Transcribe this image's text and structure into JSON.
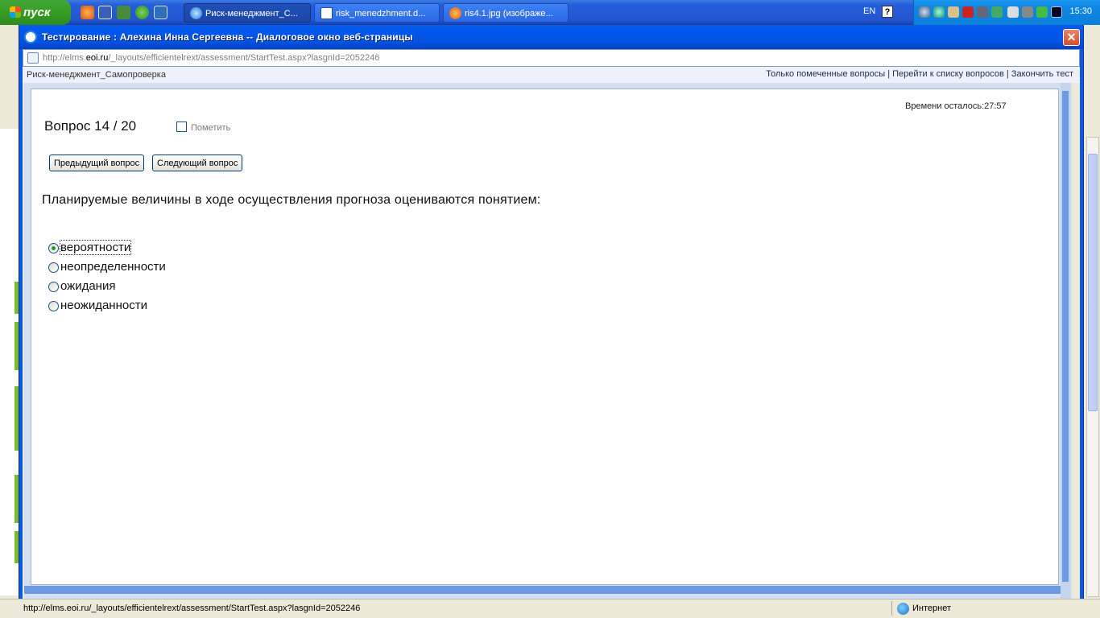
{
  "taskbar": {
    "start_label": "пуск",
    "tasks": [
      {
        "label": "Риск-менеджмент_С...",
        "icon": "ie-icon",
        "active": true
      },
      {
        "label": "risk_menedzhment.d...",
        "icon": "word-doc-icon",
        "active": false
      },
      {
        "label": "ris4.1.jpg (изображе...",
        "icon": "firefox-icon",
        "active": false
      }
    ],
    "language": "EN",
    "help": "?",
    "clock": "15:30"
  },
  "dialog": {
    "title": "Тестирование : Алехина Инна Сергеевна -- Диалоговое окно веб-страницы",
    "close_label": "✕",
    "address": {
      "prefix": "http://elms.",
      "domain": "eoi.ru",
      "path": "/_layouts/efficientelrext/assessment/StartTest.aspx?lasgnId=2052246"
    },
    "course_name": "Риск-менеджмент_Самопроверка",
    "links": {
      "marked_only": "Только помеченные вопросы",
      "sep1": "|",
      "go_to_list": "Перейти к списку вопросов",
      "sep2": "|",
      "finish": "Закончить тест"
    }
  },
  "test": {
    "time_left": "Времени осталось:27:57",
    "question_title": "Вопрос 14 / 20",
    "mark_label": "Пометить",
    "prev_button": "Предыдущий вопрос",
    "next_button": "Следующий вопрос",
    "question_text": "Планируемые величины в ходе осуществления прогноза оцениваются понятием:",
    "answers": [
      {
        "label": "вероятности",
        "selected": true
      },
      {
        "label": "неопределенности",
        "selected": false
      },
      {
        "label": "ожидания",
        "selected": false
      },
      {
        "label": "неожиданности",
        "selected": false
      }
    ]
  },
  "status_bar": {
    "url": "http://elms.eoi.ru/_layouts/efficientelrext/assessment/StartTest.aspx?lasgnId=2052246",
    "zone": "Интернет"
  }
}
